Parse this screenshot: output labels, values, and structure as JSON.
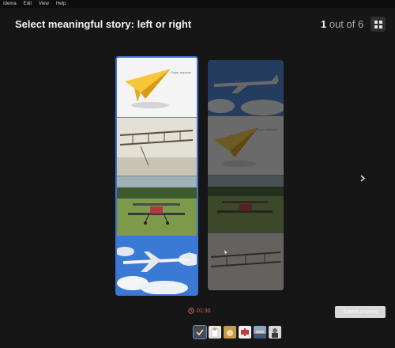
{
  "menu": {
    "items": [
      "Idema",
      "Edit",
      "View",
      "Help"
    ]
  },
  "header": {
    "title": "Select meaningful story: left or right"
  },
  "progress": {
    "current": "1",
    "suffix": " out of 6"
  },
  "left_story": {
    "panel1_caption": "Paper airplane"
  },
  "right_story": {
    "panel2_caption": "Paper airplane"
  },
  "timer": {
    "text": "01:30"
  },
  "submit": {
    "label": "Submit answers"
  },
  "icons": {
    "grid": "grid-icon",
    "next": "chevron-right-icon",
    "timer": "clock-icon",
    "check": "check-icon"
  },
  "colors": {
    "selected_border": "#3f6fd3",
    "timer": "#e06060",
    "background": "#161616"
  }
}
